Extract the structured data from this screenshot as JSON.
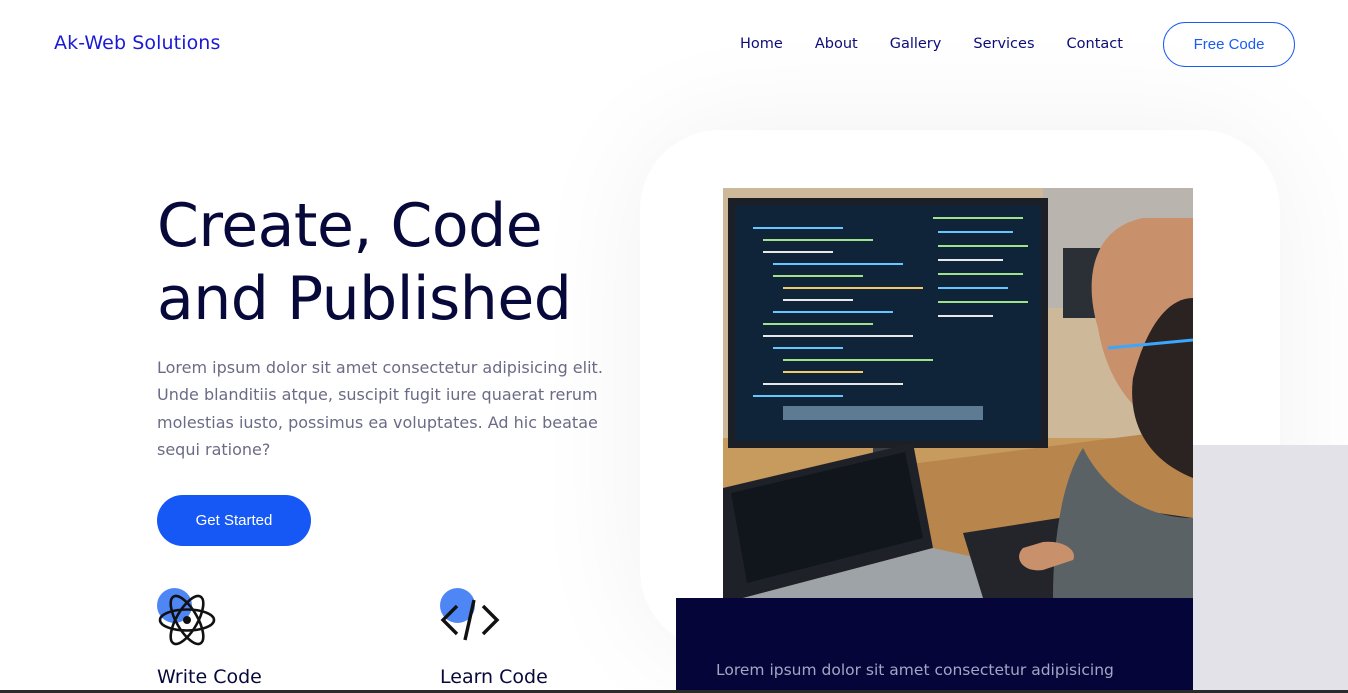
{
  "brand": {
    "logo": "Ak-Web Solutions"
  },
  "nav": {
    "links": [
      "Home",
      "About",
      "Gallery",
      "Services",
      "Contact"
    ],
    "cta": "Free Code"
  },
  "hero": {
    "title_line1": "Create, Code",
    "title_line2": "and Published",
    "description": "Lorem ipsum dolor sit amet consectetur adipisicing elit. Unde blanditiis atque, suscipit fugit iure quaerat rerum molestias iusto, possimus ea voluptates. Ad hic beatae sequi ratione?",
    "button": "Get Started"
  },
  "features": [
    {
      "title": "Write Code",
      "icon": "atom-icon"
    },
    {
      "title": "Learn Code",
      "icon": "code-brackets-icon"
    }
  ],
  "card": {
    "text": "Lorem ipsum dolor sit amet consectetur adipisicing"
  },
  "colors": {
    "brand_blue": "#1658f5",
    "navy": "#05053a",
    "text_dark": "#07093a",
    "muted_text": "#6b6b86",
    "accent_dot": "#4f86f5"
  }
}
